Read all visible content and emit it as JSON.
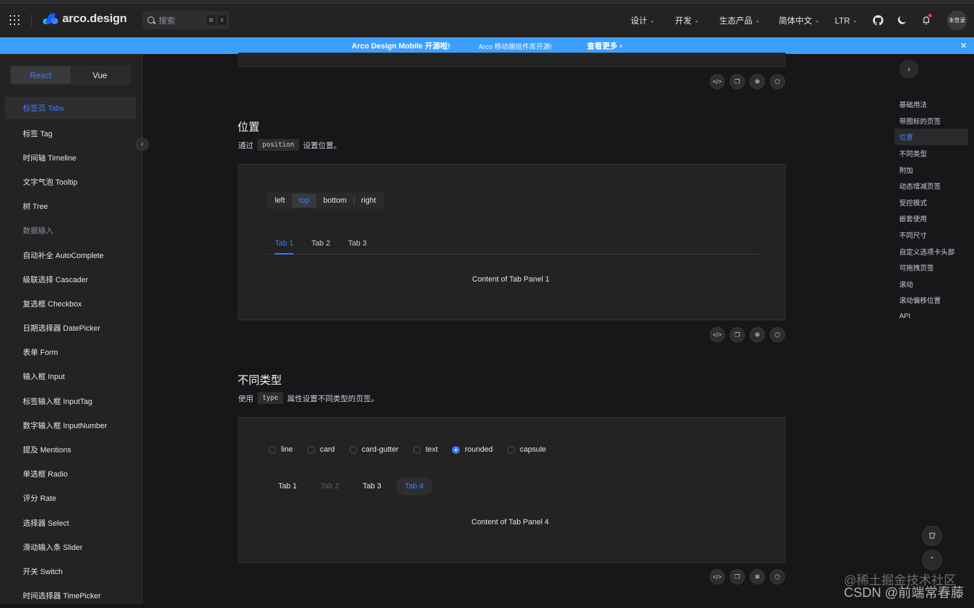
{
  "navbar": {
    "logo_text": "arco.design",
    "search_placeholder": "搜索",
    "search_kbd": [
      "⌘",
      "K"
    ],
    "menus": [
      {
        "label": "设计"
      },
      {
        "label": "开发"
      },
      {
        "label": "生态产品"
      },
      {
        "label": "简体中文"
      },
      {
        "label": "LTR"
      }
    ],
    "icons": [
      "github-icon",
      "moon-icon",
      "bell-icon"
    ],
    "avatar_label": "未登录"
  },
  "banner": {
    "title": "Arco Design Mobile 开源啦!",
    "subtitle": "Arco 移动端组件库开源!",
    "link": "查看更多",
    "color": "#3c9fff"
  },
  "sidebar": {
    "frameworks": [
      "React",
      "Vue"
    ],
    "active_framework": "React",
    "items": [
      {
        "label": "标签页 Tabs",
        "active": true
      },
      {
        "label": "标签 Tag"
      },
      {
        "label": "时间轴 Timeline"
      },
      {
        "label": "文字气泡 Tooltip"
      },
      {
        "label": "树 Tree"
      },
      {
        "label": "数据输入",
        "group": true
      },
      {
        "label": "自动补全 AutoComplete"
      },
      {
        "label": "级联选择 Cascader"
      },
      {
        "label": "复选框 Checkbox"
      },
      {
        "label": "日期选择器 DatePicker"
      },
      {
        "label": "表单 Form"
      },
      {
        "label": "输入框 Input"
      },
      {
        "label": "标签输入框 InputTag"
      },
      {
        "label": "数字输入框 InputNumber"
      },
      {
        "label": "提及 Mentions"
      },
      {
        "label": "单选框 Radio"
      },
      {
        "label": "评分 Rate"
      },
      {
        "label": "选择器 Select"
      },
      {
        "label": "滑动输入条 Slider"
      },
      {
        "label": "开关 Switch"
      },
      {
        "label": "时间选择器 TimePicker"
      }
    ]
  },
  "sections": {
    "position": {
      "title": "位置",
      "desc_before": "通过",
      "code": "position",
      "desc_after": "设置位置。",
      "options": [
        "left",
        "top",
        "bottom",
        "right"
      ],
      "selected_option": "top",
      "tabs": [
        "Tab 1",
        "Tab 2",
        "Tab 3"
      ],
      "active_tab": "Tab 1",
      "panel_content": "Content of Tab Panel 1"
    },
    "type": {
      "title": "不同类型",
      "desc_before": "使用",
      "code": "type",
      "desc_after": "属性设置不同类型的页签。",
      "options": [
        "line",
        "card",
        "card-gutter",
        "text",
        "rounded",
        "capsule"
      ],
      "selected_option": "rounded",
      "tabs": [
        "Tab 1",
        "Tab 2",
        "Tab 3",
        "Tab 4"
      ],
      "disabled_tab": "Tab 2",
      "active_tab": "Tab 4",
      "panel_content": "Content of Tab Panel 4"
    }
  },
  "demo_actions": [
    "code-icon",
    "copy-icon",
    "codesandbox-icon",
    "codepen-icon"
  ],
  "toc": {
    "items": [
      "基础用法",
      "带图标的页签",
      "位置",
      "不同类型",
      "附加",
      "动态增减页签",
      "受控模式",
      "嵌套使用",
      "不同尺寸",
      "自定义选项卡头部",
      "可拖拽页签",
      "滚动",
      "滚动偏移位置",
      "API"
    ],
    "active": "位置"
  },
  "watermark": {
    "line1": "@稀土掘金技术社区",
    "line2": "CSDN @前端常春藤"
  },
  "colors": {
    "accent": "#3c7eff",
    "background": "#17171a",
    "panel": "#232324"
  }
}
